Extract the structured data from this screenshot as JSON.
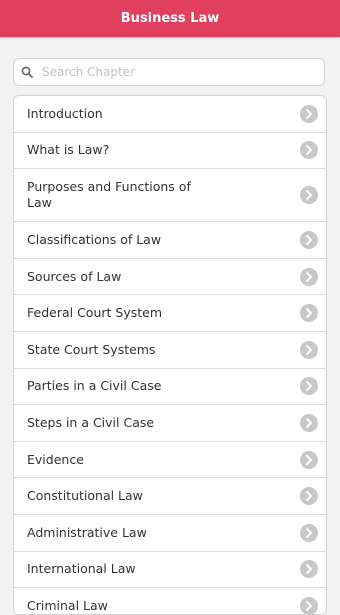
{
  "header": {
    "title": "Business Law"
  },
  "search": {
    "placeholder": "Search Chapter",
    "value": ""
  },
  "colors": {
    "header_bg": "#e0405e",
    "chevron": "#c8c8c8"
  },
  "chapters": [
    {
      "label": "Introduction"
    },
    {
      "label": "What is Law?"
    },
    {
      "label": "Purposes and Functions of Law"
    },
    {
      "label": "Classifications of Law"
    },
    {
      "label": "Sources of Law"
    },
    {
      "label": "Federal Court System"
    },
    {
      "label": "State Court Systems"
    },
    {
      "label": "Parties in a Civil Case"
    },
    {
      "label": "Steps in a Civil Case"
    },
    {
      "label": "Evidence"
    },
    {
      "label": "Constitutional Law"
    },
    {
      "label": "Administrative Law"
    },
    {
      "label": "International Law"
    },
    {
      "label": "Criminal Law"
    }
  ]
}
